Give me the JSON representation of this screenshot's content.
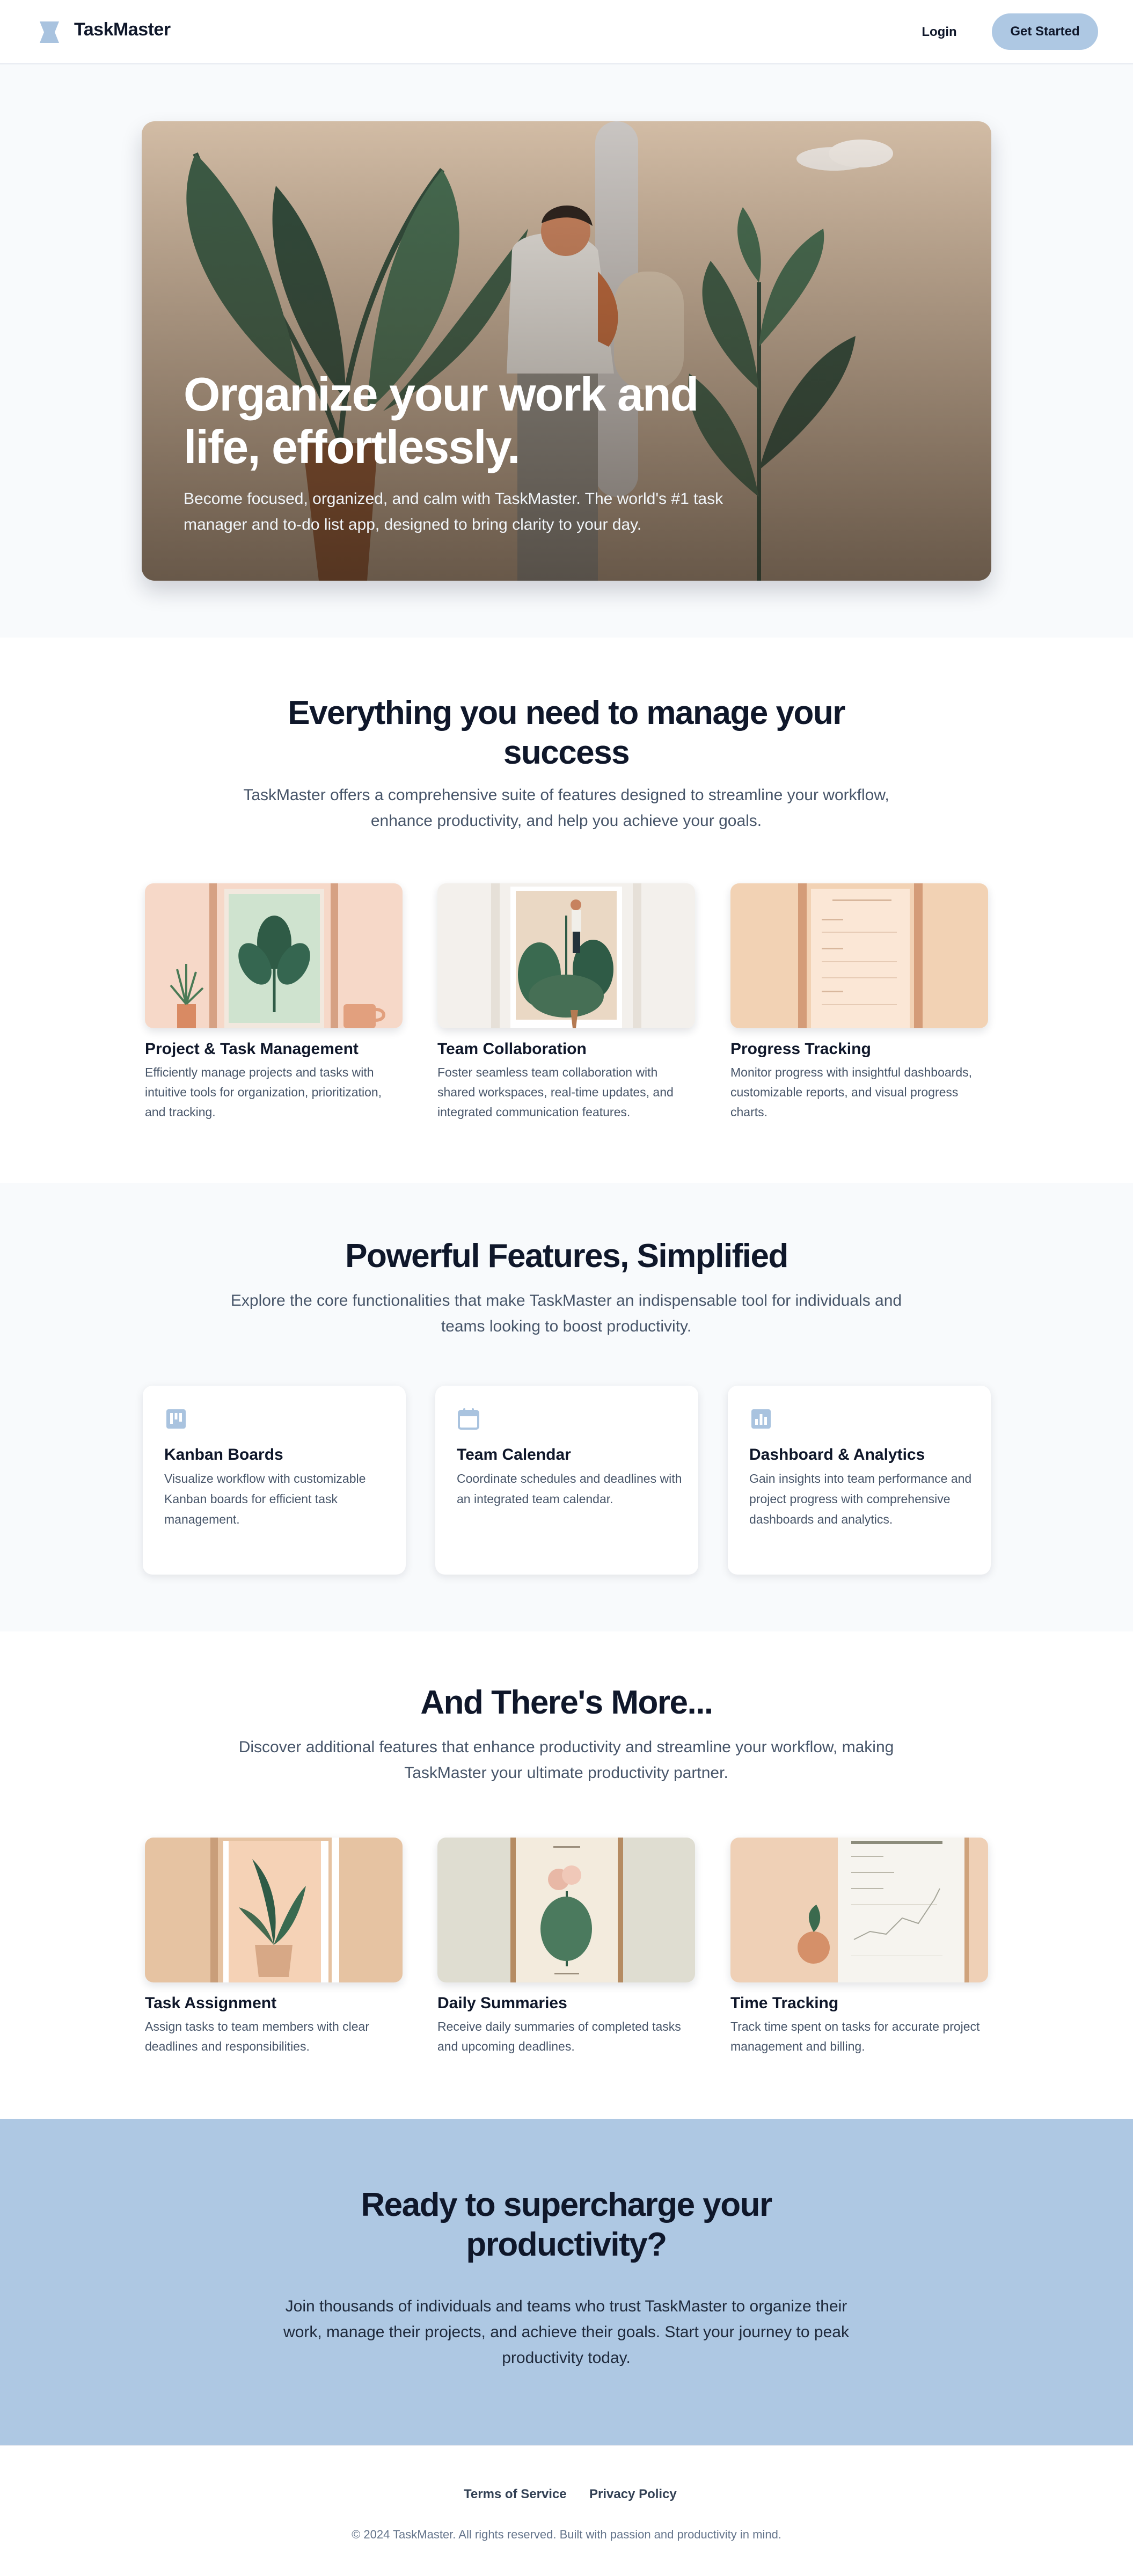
{
  "header": {
    "brand": "TaskMaster",
    "login_label": "Login",
    "cta_label": "Get Started"
  },
  "hero": {
    "title": "Organize your work and life, effortlessly.",
    "subtitle": "Become focused, organized, and calm with TaskMaster. The world's #1 task manager and to-do list app, designed to bring clarity to your day."
  },
  "features_intro": {
    "title": "Everything you need to manage your success",
    "subtitle": "TaskMaster offers a comprehensive suite of features designed to streamline your workflow, enhance productivity, and help you achieve your goals.",
    "cards": [
      {
        "title": "Project & Task Management",
        "description": "Efficiently manage projects and tasks with intuitive tools for organization, prioritization, and tracking."
      },
      {
        "title": "Team Collaboration",
        "description": "Foster seamless team collaboration with shared workspaces, real-time updates, and integrated communication features."
      },
      {
        "title": "Progress Tracking",
        "description": "Monitor progress with insightful dashboards, customizable reports, and visual progress charts."
      }
    ]
  },
  "core_features": {
    "title": "Powerful Features, Simplified",
    "subtitle": "Explore the core functionalities that make TaskMaster an indispensable tool for individuals and teams looking to boost productivity.",
    "cards": [
      {
        "icon": "kanban-icon",
        "title": "Kanban Boards",
        "description": "Visualize workflow with customizable Kanban boards for efficient task management."
      },
      {
        "icon": "calendar-icon",
        "title": "Team Calendar",
        "description": "Coordinate schedules and deadlines with an integrated team calendar."
      },
      {
        "icon": "bar-chart-icon",
        "title": "Dashboard & Analytics",
        "description": "Gain insights into team performance and project progress with comprehensive dashboards and analytics."
      }
    ]
  },
  "more_features": {
    "title": "And There's More...",
    "subtitle": "Discover additional features that enhance productivity and streamline your workflow, making TaskMaster your ultimate productivity partner.",
    "cards": [
      {
        "title": "Task Assignment",
        "description": "Assign tasks to team members with clear deadlines and responsibilities."
      },
      {
        "title": "Daily Summaries",
        "description": "Receive daily summaries of completed tasks and upcoming deadlines."
      },
      {
        "title": "Time Tracking",
        "description": "Track time spent on tasks for accurate project management and billing."
      }
    ]
  },
  "cta": {
    "title": "Ready to supercharge your productivity?",
    "subtitle": "Join thousands of individuals and teams who trust TaskMaster to organize their work, manage their projects, and achieve their goals. Start your journey to peak productivity today."
  },
  "footer": {
    "terms_label": "Terms of Service",
    "privacy_label": "Privacy Policy",
    "copyright": "© 2024 TaskMaster. All rights reserved. Built with passion and productivity in mind."
  },
  "colors": {
    "accent": "#aec8e3",
    "heading": "#0f172a",
    "body_text": "#475569",
    "icon": "#a9c3df"
  }
}
